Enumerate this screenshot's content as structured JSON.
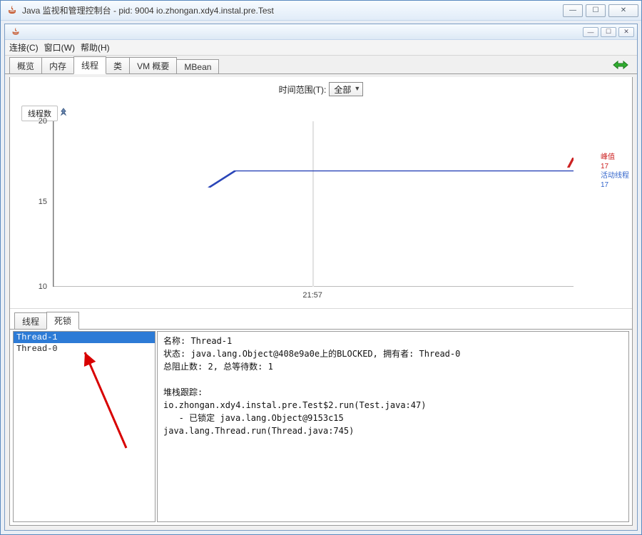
{
  "window": {
    "title": "Java 监视和管理控制台 - pid: 9004 io.zhongan.xdy4.instal.pre.Test",
    "min_glyph": "—",
    "max_glyph": "☐",
    "close_glyph": "✕"
  },
  "sub_window": {
    "min_glyph": "—",
    "max_glyph": "☐",
    "close_glyph": "✕"
  },
  "menubar": {
    "connect": "连接(C)",
    "window": "窗口(W)",
    "help": "帮助(H)"
  },
  "tabs": {
    "overview": "概览",
    "memory": "内存",
    "threads": "线程",
    "classes": "类",
    "vm": "VM 概要",
    "mbean": "MBean"
  },
  "range": {
    "label": "时间范围(T):",
    "value": "全部"
  },
  "chart_title": "线程数",
  "chart_data": {
    "type": "line",
    "ylabel": "",
    "xlabel": "",
    "y_ticks": [
      10,
      15,
      20
    ],
    "x_ticks": [
      "21:57"
    ],
    "ylim": [
      10,
      20
    ],
    "series": [
      {
        "name": "活动线程",
        "color": "#2a45b8",
        "points": [
          [
            0.3,
            16
          ],
          [
            0.35,
            17
          ],
          [
            1.0,
            17
          ]
        ]
      }
    ],
    "legend": {
      "peak_label": "峰值",
      "peak_value": "17",
      "live_label": "活动线程",
      "live_value": "17"
    }
  },
  "sub_tabs": {
    "threads": "线程",
    "deadlock": "死锁"
  },
  "thread_list": [
    {
      "name": "Thread-1",
      "selected": true
    },
    {
      "name": "Thread-0",
      "selected": false
    }
  ],
  "detail": {
    "name_label": "名称: ",
    "name_value": "Thread-1",
    "state_label": "状态: ",
    "state_value": "java.lang.Object@408e9a0e上的BLOCKED, 拥有者: Thread-0",
    "blocked_label": "总阻止数: ",
    "blocked_value": "2",
    "waited_sep": ", 总等待数: ",
    "waited_value": "1",
    "stack_label": "堆栈跟踪: ",
    "stack_line1": "io.zhongan.xdy4.instal.pre.Test$2.run(Test.java:47)",
    "stack_line2": "   - 已锁定 java.lang.Object@9153c15",
    "stack_line3": "java.lang.Thread.run(Thread.java:745)"
  }
}
